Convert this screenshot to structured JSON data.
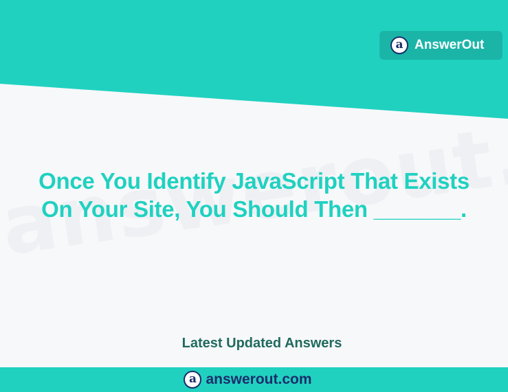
{
  "brand": {
    "logo_letter": "a",
    "name": "AnswerOut"
  },
  "watermark": "answerout.com",
  "question": {
    "line1": "Once You Identify JavaScript That Exists",
    "line2": "On Your Site, You Should Then _______."
  },
  "tagline": "Latest Updated Answers",
  "footer": {
    "logo_letter": "a",
    "url": "answerout.com"
  },
  "colors": {
    "teal": "#20d1c0",
    "badge": "#1bb5a8",
    "navy": "#1b2d6b",
    "dark_green": "#1f6a5e",
    "background": "#f7f8fa"
  }
}
